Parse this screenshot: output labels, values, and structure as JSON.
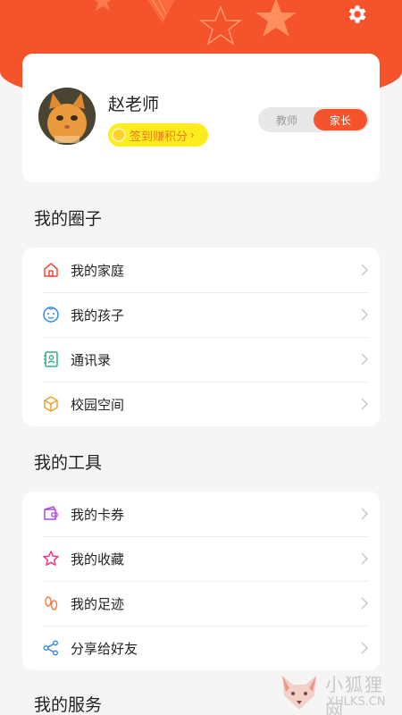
{
  "header": {
    "settings_icon": "gear-icon",
    "bg_color": "#f4532b"
  },
  "profile": {
    "name": "赵老师",
    "sign_in_label": "签到赚积分",
    "role_options": [
      "教师",
      "家长"
    ],
    "active_role": "家长"
  },
  "sections": [
    {
      "title": "我的圈子",
      "items": [
        {
          "label": "我的家庭",
          "icon": "home-icon"
        },
        {
          "label": "我的孩子",
          "icon": "child-face-icon"
        },
        {
          "label": "通讯录",
          "icon": "contacts-icon"
        },
        {
          "label": "校园空间",
          "icon": "cube-icon"
        }
      ]
    },
    {
      "title": "我的工具",
      "items": [
        {
          "label": "我的卡券",
          "icon": "wallet-icon"
        },
        {
          "label": "我的收藏",
          "icon": "star-icon"
        },
        {
          "label": "我的足迹",
          "icon": "footprint-icon"
        },
        {
          "label": "分享给好友",
          "icon": "share-icon"
        }
      ]
    },
    {
      "title": "我的服务",
      "items": []
    }
  ],
  "watermark": {
    "cn": "小狐狸网",
    "en": "XHLKS.CN"
  }
}
